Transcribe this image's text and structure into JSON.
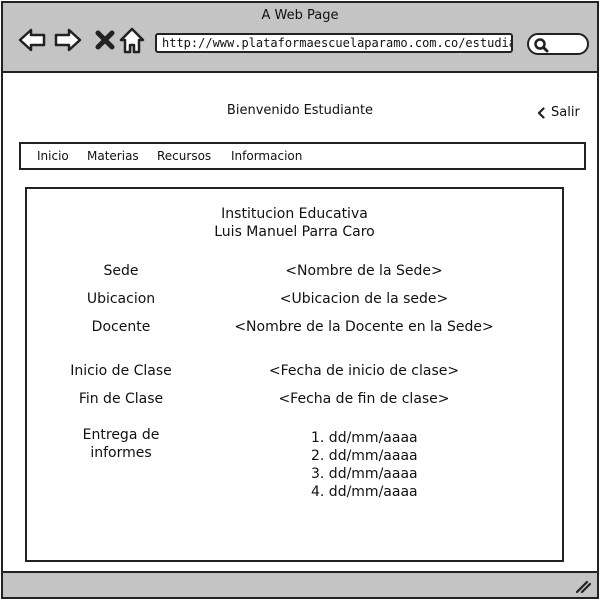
{
  "window": {
    "title": "A Web Page",
    "url": "http://www.plataformaescuelaparamo.com.co/estudiante"
  },
  "header": {
    "welcome": "Bienvenido Estudiante",
    "logout_label": "Salir"
  },
  "menu": {
    "items": [
      "Inicio",
      "Materias",
      "Recursos",
      "Informacion"
    ]
  },
  "institution": {
    "line1": "Institucion Educativa",
    "line2": "Luis Manuel Parra Caro"
  },
  "details": {
    "sede_label": "Sede",
    "sede_value": "<Nombre de la Sede>",
    "ubicacion_label": "Ubicacion",
    "ubicacion_value": "<Ubicacion de la sede>",
    "docente_label": "Docente",
    "docente_value": "<Nombre de la Docente en la Sede>",
    "inicio_label": "Inicio  de Clase",
    "inicio_value": "<Fecha de inicio de clase>",
    "fin_label": "Fin  de Clase",
    "fin_value": "<Fecha de fin de clase>",
    "entrega_label_1": "Entrega de",
    "entrega_label_2": "informes",
    "entrega_dates": [
      "1. dd/mm/aaaa",
      "2. dd/mm/aaaa",
      "3. dd/mm/aaaa",
      "4. dd/mm/aaaa"
    ]
  },
  "icons": {
    "back": "back-arrow-icon",
    "forward": "forward-arrow-icon",
    "close": "close-icon",
    "home": "home-icon",
    "search": "search-icon",
    "logout": "chevron-left-icon",
    "resize": "resize-grip-icon"
  }
}
